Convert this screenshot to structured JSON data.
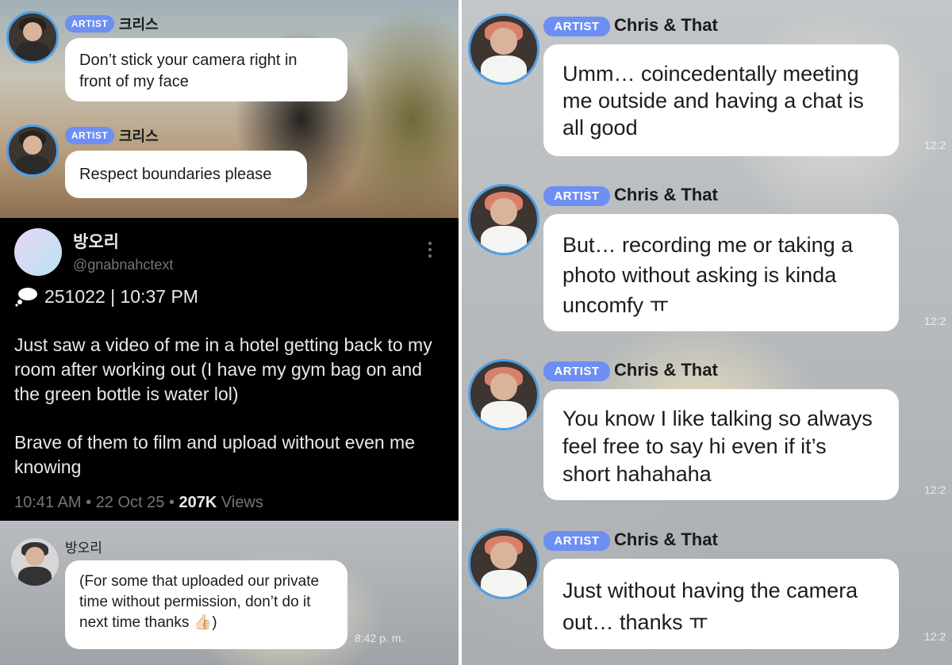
{
  "left_top": {
    "messages": [
      {
        "badge": "ARTIST",
        "name": "크리스",
        "text": "Don’t stick your camera right in front of my face"
      },
      {
        "badge": "ARTIST",
        "name": "크리스",
        "text": "Respect boundaries please"
      }
    ]
  },
  "tweet": {
    "display_name": "방오리",
    "handle": "@gnabnahctext",
    "date_line": "251022 | 10:37 PM",
    "paragraph_1": "Just saw a video of me in a hotel getting back to my room after working out (I have my gym bag on and the green bottle is water lol)",
    "paragraph_2": "Brave of them to film and upload without even me knowing",
    "time": "10:41 AM",
    "sep1": "•",
    "date": "22 Oct 25",
    "sep2": "•",
    "views_count": "207K",
    "views_label": "Views"
  },
  "left_bottom": {
    "name": "방오리",
    "text": "(For some that uploaded our private time without permission, don’t do it next time thanks 👍🏻)",
    "timestamp": "8:42 p. m."
  },
  "right": {
    "messages": [
      {
        "badge": "ARTIST",
        "name": "Chris & That",
        "text": "Umm… coincedentally meeting me outside and having a chat is all good",
        "time": "12:2"
      },
      {
        "badge": "ARTIST",
        "name": "Chris & That",
        "text": "But… recording me or taking a photo without asking is kinda uncomfy ㅠ",
        "time": "12:2"
      },
      {
        "badge": "ARTIST",
        "name": "Chris & That",
        "text": "You know I like talking so always feel free to say hi even if it’s short hahahaha",
        "time": "12:2"
      },
      {
        "badge": "ARTIST",
        "name": "Chris & That",
        "text": "Just without having the camera out… thanks ㅠ",
        "time": "12:2"
      }
    ]
  }
}
